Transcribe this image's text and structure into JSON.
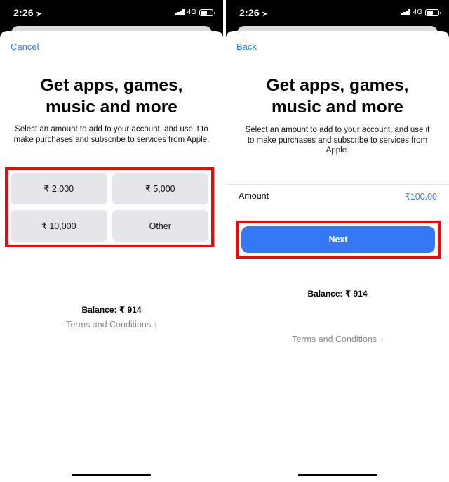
{
  "status_bar": {
    "time": "2:26",
    "location_icon": "location-arrow-icon",
    "network": "4G",
    "signal_icon": "cellular-signal-icon",
    "battery_icon": "battery-icon",
    "battery_level_fraction": 0.55
  },
  "left_screen": {
    "nav_button": "Cancel",
    "title": "Get apps, games, music and more",
    "title_line1": "Get apps, games,",
    "title_line2": "music and more",
    "subtitle": "Select an amount to add to your account, and use it to make purchases and subscribe to services from Apple.",
    "amounts": [
      {
        "label": "₹ 2,000"
      },
      {
        "label": "₹ 5,000"
      },
      {
        "label": "₹ 10,000"
      },
      {
        "label": "Other"
      }
    ],
    "balance": "Balance: ₹ 914",
    "terms_link": "Terms and Conditions",
    "terms_chevron": "›",
    "highlight_color": "#ff0000"
  },
  "right_screen": {
    "nav_button": "Back",
    "title_line1": "Get apps, games,",
    "title_line2": "music and more",
    "subtitle": "Select an amount to add to your account, and use it to make purchases and subscribe to services from Apple.",
    "amount_label": "Amount",
    "amount_value": "₹100.00",
    "next_button": "Next",
    "balance": "Balance: ₹ 914",
    "terms_link": "Terms and Conditions",
    "terms_chevron": "›",
    "highlight_color": "#ff0000"
  },
  "colors": {
    "accent_blue": "#2f7cf6",
    "button_blue": "#3478f6",
    "amount_button_bg": "#e6e6ea",
    "muted_text": "#8a8a8e"
  }
}
